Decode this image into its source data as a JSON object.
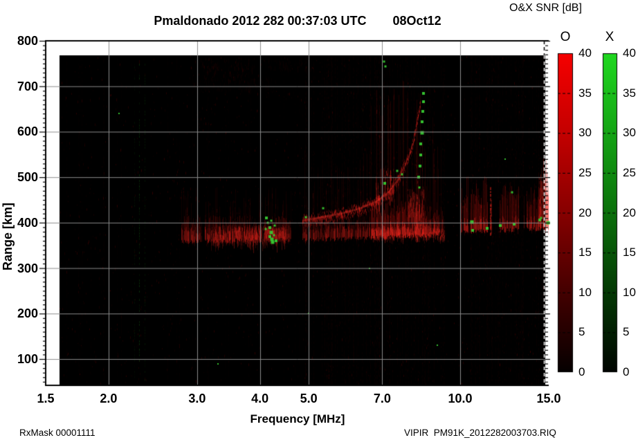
{
  "header": {
    "title": "Pmaldonado 2012 282 00:37:03 UTC",
    "date": "08Oct12"
  },
  "footer": {
    "left": "RxMask 00001111",
    "right": "VIPIR  PM91K_2012282003703.RIQ"
  },
  "axes": {
    "x": {
      "label": "Frequency [MHz]",
      "scale": "log",
      "min": 1.5,
      "max": 15,
      "ticks": [
        1.5,
        2.0,
        3.0,
        4.0,
        5.0,
        7.0,
        10.0,
        15.0
      ],
      "tick_labels": [
        "1.5",
        "2.0",
        "3.0",
        "4.0",
        "5.0",
        "7.0",
        "10.0",
        "15.0"
      ]
    },
    "y": {
      "label": "Range [km]",
      "min": 42,
      "max": 800,
      "minor_step": 10,
      "ticks": [
        800,
        700,
        600,
        500,
        400,
        300,
        200,
        100
      ]
    }
  },
  "colorbar": {
    "title": "O&X SNR [dB]",
    "o_label": "O",
    "x_label": "X",
    "range": [
      0,
      40
    ],
    "ticks": [
      40,
      35,
      30,
      25,
      20,
      15,
      10,
      5,
      0
    ],
    "o_gradient": [
      [
        0,
        "#f60000"
      ],
      [
        0.25,
        "#c40000"
      ],
      [
        0.5,
        "#870000"
      ],
      [
        0.78,
        "#3c0000"
      ],
      [
        1,
        "#050000"
      ]
    ],
    "x_gradient": [
      [
        0,
        "#20d820"
      ],
      [
        0.25,
        "#14a414"
      ],
      [
        0.5,
        "#0b700b"
      ],
      [
        0.78,
        "#033203"
      ],
      [
        1,
        "#000400"
      ]
    ],
    "grid_color": "#8c8c8c"
  },
  "chart_data": {
    "type": "heatmap",
    "title": "Pmaldonado 2012 282 00:37:03 UTC 08Oct12",
    "xlabel": "Frequency [MHz]",
    "ylabel": "Range [km]",
    "xlim": [
      1.5,
      15
    ],
    "ylim": [
      42,
      800
    ],
    "x_scale": "log",
    "value_label": "O&X SNR [dB]",
    "value_range": [
      0,
      40
    ],
    "data_extent": {
      "f_min": 1.62,
      "f_max": 14.97,
      "km_top": 765
    },
    "echo_regions": [
      {
        "mode": "O",
        "f1": 2.78,
        "f2": 4.6,
        "base1": 358,
        "base2": 362,
        "core": 400,
        "spread": 480,
        "i": 0.55,
        "gap": 0.1
      },
      {
        "mode": "O",
        "f1": 4.86,
        "f2": 6.62,
        "base1": 362,
        "base2": 366,
        "core": 400,
        "spread": 560,
        "i": 0.5,
        "gap": 0.12
      },
      {
        "mode": "O",
        "f1": 6.65,
        "f2": 8.45,
        "base1": 366,
        "base2": 372,
        "core": 430,
        "spread": 720,
        "i": 0.8,
        "gap": 0.1
      },
      {
        "mode": "O",
        "f1": 8.45,
        "f2": 9.28,
        "base1": 372,
        "base2": 376,
        "core": 420,
        "spread": 640,
        "i": 0.7,
        "gap": 0.12
      },
      {
        "mode": "O",
        "f1": 10.02,
        "f2": 11.32,
        "base1": 380,
        "base2": 382,
        "core": 470,
        "spread": 520,
        "i": 0.7,
        "gap": 0.15
      },
      {
        "mode": "O",
        "f1": 11.98,
        "f2": 13.08,
        "base1": 382,
        "base2": 385,
        "core": 455,
        "spread": 500,
        "i": 0.6,
        "gap": 0.15
      },
      {
        "mode": "O",
        "f1": 13.38,
        "f2": 14.3,
        "base1": 385,
        "base2": 386,
        "core": 460,
        "spread": 510,
        "i": 0.6,
        "gap": 0.15
      },
      {
        "mode": "O",
        "f1": 14.3,
        "f2": 14.97,
        "base1": 386,
        "base2": 388,
        "core": 500,
        "spread": 530,
        "i": 0.8,
        "gap": 0.06
      }
    ],
    "bright_patches": [
      {
        "f1": 6.8,
        "f2": 7.35,
        "km1": 455,
        "km2": 520,
        "i": 0.55
      },
      {
        "f1": 7.85,
        "f2": 8.45,
        "km1": 420,
        "km2": 480,
        "i": 0.5
      },
      {
        "f1": 3.2,
        "f2": 4.5,
        "km1": 358,
        "km2": 395,
        "i": 0.45
      },
      {
        "f1": 6.7,
        "f2": 9.3,
        "km1": 368,
        "km2": 390,
        "i": 0.5
      },
      {
        "f1": 14.35,
        "f2": 14.95,
        "km1": 420,
        "km2": 500,
        "i": 0.55
      }
    ],
    "o_trace": {
      "width_km": 16,
      "i": 0.6,
      "points": [
        [
          4.85,
          405
        ],
        [
          5.3,
          413
        ],
        [
          5.8,
          421
        ],
        [
          6.3,
          432
        ],
        [
          6.8,
          447
        ],
        [
          7.2,
          468
        ],
        [
          7.55,
          498
        ],
        [
          7.85,
          540
        ],
        [
          8.1,
          588
        ],
        [
          8.25,
          635
        ],
        [
          8.35,
          672
        ]
      ]
    },
    "bright_columns": [
      {
        "f": 11.45,
        "km1": 372,
        "km2": 478,
        "i": 0.75
      },
      {
        "f": 11.5,
        "km1": 375,
        "km2": 450,
        "i": 0.4
      }
    ],
    "second_hop": [
      {
        "f1": 3.05,
        "f2": 3.9,
        "km1": 715,
        "km2": 763,
        "i": 0.3
      },
      {
        "f1": 4.15,
        "f2": 5.05,
        "km1": 735,
        "km2": 763,
        "i": 0.15
      },
      {
        "f1": 2.95,
        "f2": 4.3,
        "km1": 690,
        "km2": 720,
        "i": 0.12
      }
    ],
    "x_trace_dots": [
      [
        8.27,
        500,
        4
      ],
      [
        8.31,
        524,
        4
      ],
      [
        8.34,
        549,
        4
      ],
      [
        8.36,
        573,
        4
      ],
      [
        8.39,
        598,
        5
      ],
      [
        8.41,
        622,
        4
      ],
      [
        8.43,
        645,
        4
      ],
      [
        8.45,
        666,
        4
      ],
      [
        8.46,
        684,
        4
      ],
      [
        8.3,
        478,
        3
      ]
    ],
    "green_cluster": [
      [
        4.12,
        410,
        4
      ],
      [
        4.15,
        399,
        3
      ],
      [
        4.18,
        389,
        4
      ],
      [
        4.21,
        379,
        5
      ],
      [
        4.18,
        369,
        4
      ],
      [
        4.23,
        363,
        5
      ],
      [
        4.26,
        373,
        3
      ],
      [
        4.11,
        386,
        3
      ],
      [
        4.28,
        394,
        3
      ],
      [
        4.21,
        404,
        3
      ],
      [
        4.3,
        360,
        4
      ],
      [
        4.24,
        357,
        5
      ]
    ],
    "green_scatter": [
      [
        7.08,
        487,
        4
      ],
      [
        7.5,
        514,
        3
      ],
      [
        7.66,
        507,
        3
      ],
      [
        5.35,
        431,
        3
      ],
      [
        4.93,
        412,
        3
      ],
      [
        10.55,
        402,
        5
      ],
      [
        10.6,
        383,
        4
      ],
      [
        11.3,
        388,
        4
      ],
      [
        12.0,
        393,
        4
      ],
      [
        12.8,
        396,
        4
      ],
      [
        12.7,
        467,
        3
      ],
      [
        14.4,
        406,
        4
      ],
      [
        14.5,
        410,
        3
      ],
      [
        6.6,
        300,
        2
      ],
      [
        7.05,
        754,
        3
      ],
      [
        7.1,
        744,
        3
      ],
      [
        2.1,
        640,
        2
      ],
      [
        5.0,
        200,
        2
      ],
      [
        9.0,
        130,
        2
      ],
      [
        12.3,
        540,
        2
      ],
      [
        3.3,
        90,
        2
      ],
      [
        14.93,
        400,
        5
      ]
    ],
    "green_columns": [
      {
        "f": 2.3,
        "i": 0.28
      },
      {
        "f": 2.36,
        "i": 0.16
      },
      {
        "f": 2.25,
        "i": 0.12
      }
    ],
    "noise_zones": [
      {
        "f1": 4.9,
        "f2": 9.4,
        "p": 0.3,
        "a": 0.07
      },
      {
        "f1": 10.0,
        "f2": 14.97,
        "p": 0.2,
        "a": 0.06
      },
      {
        "f1": 1.62,
        "f2": 14.97,
        "p": 0.06,
        "a": 0.04
      }
    ]
  }
}
